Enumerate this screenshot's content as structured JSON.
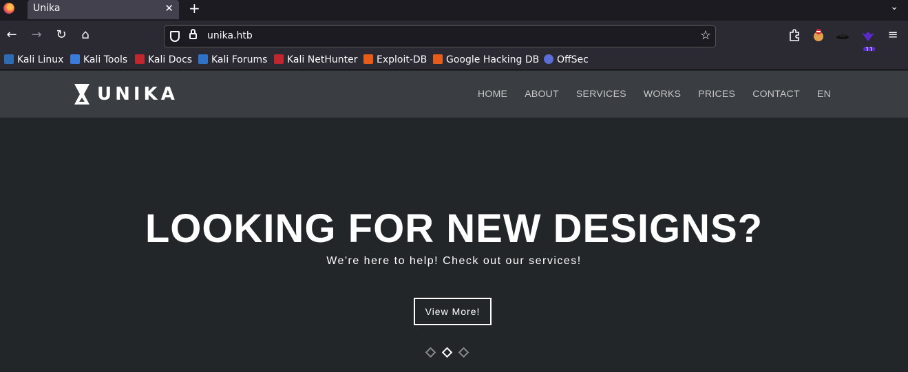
{
  "browser": {
    "tab_title": "Unika",
    "tab_close": "✕",
    "new_tab": "+",
    "tablist": "⌄",
    "back": "←",
    "forward": "→",
    "reload": "↻",
    "home": "⌂",
    "url": "unika.htb",
    "bookmark_star": "☆",
    "extensions_badge": "11",
    "menu": "≡"
  },
  "bookmarks": [
    {
      "label": "Kali Linux",
      "color": "#2d6bb5"
    },
    {
      "label": "Kali Tools",
      "color": "#3a7ad9"
    },
    {
      "label": "Kali Docs",
      "color": "#c0262d"
    },
    {
      "label": "Kali Forums",
      "color": "#2f73c9"
    },
    {
      "label": "Kali NetHunter",
      "color": "#c0262d"
    },
    {
      "label": "Exploit-DB",
      "color": "#e65c1a"
    },
    {
      "label": "Google Hacking DB",
      "color": "#e65c1a"
    },
    {
      "label": "OffSec",
      "color": "#5a6fd6"
    }
  ],
  "site": {
    "logo_text": "UNIKA",
    "nav": [
      "HOME",
      "ABOUT",
      "SERVICES",
      "WORKS",
      "PRICES",
      "CONTACT",
      "EN"
    ],
    "hero_title": "LOOKING FOR NEW DESIGNS?",
    "hero_subtitle": "We're here to help! Check out our services!",
    "cta_label": "View More!",
    "slider": {
      "count": 3,
      "active_index": 1
    }
  }
}
